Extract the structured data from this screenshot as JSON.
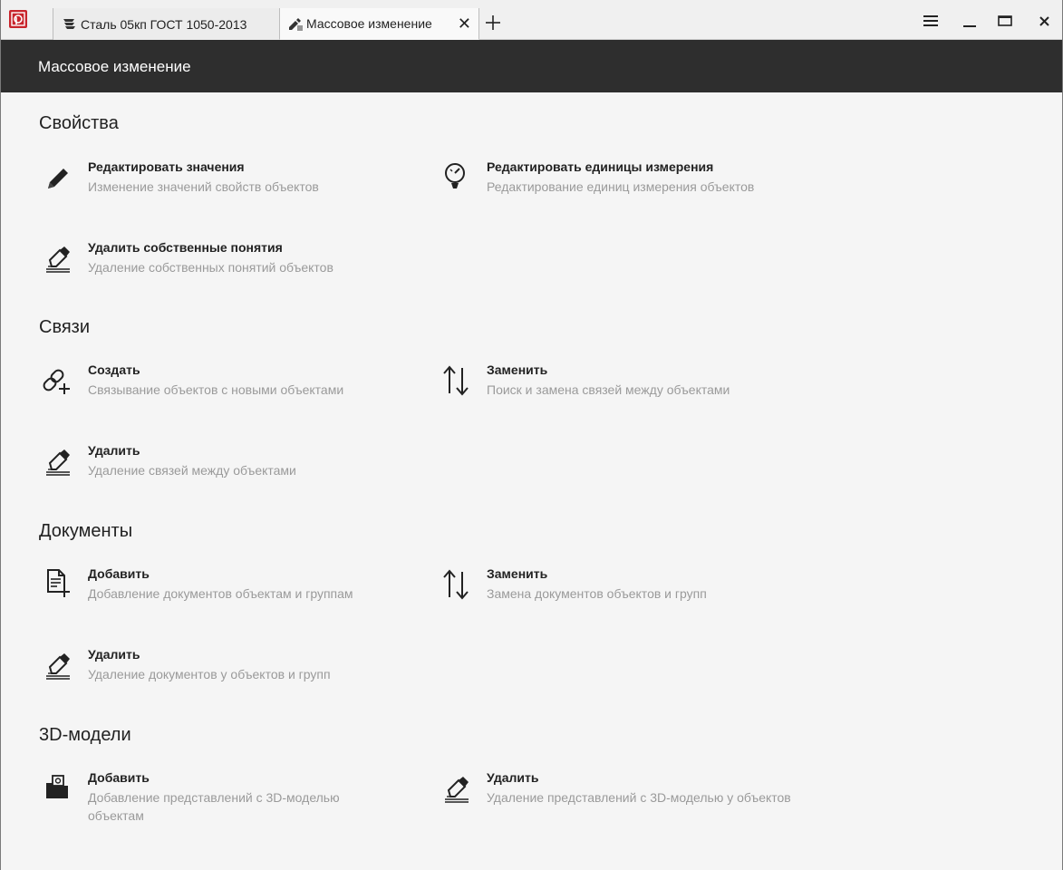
{
  "tabs": [
    {
      "label": "Сталь 05кп ГОСТ 1050-2013"
    },
    {
      "label": "Массовое изменение"
    }
  ],
  "header": {
    "title": "Массовое изменение"
  },
  "sections": [
    {
      "title": "Свойства",
      "actions": [
        {
          "icon": "pencil-icon",
          "name": "Редактировать значения",
          "desc": "Изменение значений свойств объектов"
        },
        {
          "icon": "gauge-icon",
          "name": "Редактировать единицы измерения",
          "desc": "Редактирование единиц измерения объектов"
        },
        {
          "icon": "eraser-icon",
          "name": "Удалить собственные понятия",
          "desc": "Удаление собственных понятий объектов"
        }
      ]
    },
    {
      "title": "Связи",
      "actions": [
        {
          "icon": "link-add-icon",
          "name": "Создать",
          "desc": "Связывание объектов с новыми объектами"
        },
        {
          "icon": "swap-arrows-icon",
          "name": "Заменить",
          "desc": "Поиск и замена связей между объектами"
        },
        {
          "icon": "eraser-icon",
          "name": "Удалить",
          "desc": "Удаление связей между объектами"
        }
      ]
    },
    {
      "title": "Документы",
      "actions": [
        {
          "icon": "document-add-icon",
          "name": "Добавить",
          "desc": "Добавление документов объектам и группам"
        },
        {
          "icon": "swap-arrows-icon",
          "name": "Заменить",
          "desc": "Замена документов объектов и групп"
        },
        {
          "icon": "eraser-icon",
          "name": "Удалить",
          "desc": "Удаление документов у объектов и групп"
        }
      ]
    },
    {
      "title": "3D-модели",
      "actions": [
        {
          "icon": "folder-model-icon",
          "name": "Добавить",
          "desc": "Добавление представлений с 3D-моделью объектам"
        },
        {
          "icon": "eraser-icon",
          "name": "Удалить",
          "desc": "Удаление представлений с 3D-моделью у объектов"
        }
      ]
    }
  ],
  "colors": {
    "header_bg": "#2e2e2e",
    "brand": "#c8242b",
    "desc_text": "#9a9a9a"
  }
}
